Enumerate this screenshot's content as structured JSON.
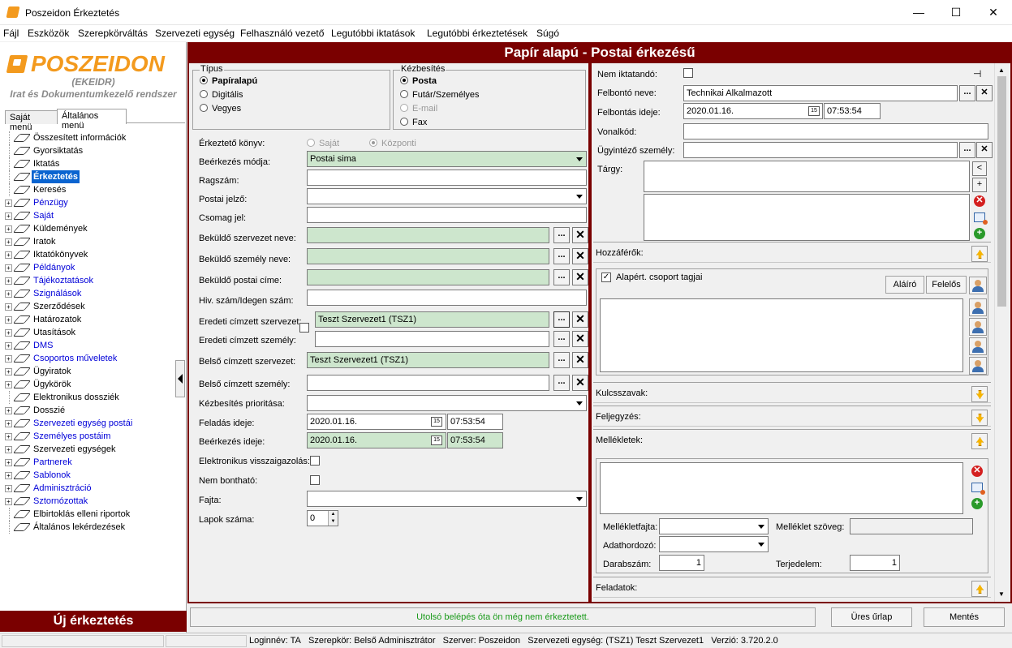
{
  "window": {
    "title": "Poszeidon Érkeztetés",
    "min": "—",
    "max": "☐",
    "close": "✕"
  },
  "menu": [
    "Fájl",
    "Eszközök",
    "Szerepkörváltás",
    "Szervezeti egység",
    "Felhasználó vezető",
    "Legutóbbi iktatások",
    "Legutóbbi érkeztetések",
    "Súgó"
  ],
  "logo": {
    "name": "POSZEIDON",
    "sub1": "(EKEIDR)",
    "sub2": "Irat és Dokumentumkezelő rendszer"
  },
  "left_tabs": [
    "Saját menü",
    "Általános menü"
  ],
  "tree": [
    {
      "label": "Összesített információk",
      "blue": false,
      "exp": false
    },
    {
      "label": "Gyorsiktatás",
      "blue": false,
      "exp": false
    },
    {
      "label": "Iktatás",
      "blue": false,
      "exp": false
    },
    {
      "label": "Érkeztetés",
      "blue": false,
      "exp": false,
      "selected": true
    },
    {
      "label": "Keresés",
      "blue": false,
      "exp": false
    },
    {
      "label": "Pénzügy",
      "blue": true,
      "exp": true
    },
    {
      "label": "Saját",
      "blue": true,
      "exp": true
    },
    {
      "label": "Küldemények",
      "blue": false,
      "exp": true
    },
    {
      "label": "Iratok",
      "blue": false,
      "exp": true
    },
    {
      "label": "Iktatókönyvek",
      "blue": false,
      "exp": true
    },
    {
      "label": "Példányok",
      "blue": true,
      "exp": true
    },
    {
      "label": "Tájékoztatások",
      "blue": true,
      "exp": true
    },
    {
      "label": "Szignálások",
      "blue": true,
      "exp": true
    },
    {
      "label": "Szerződések",
      "blue": false,
      "exp": true
    },
    {
      "label": "Határozatok",
      "blue": false,
      "exp": true
    },
    {
      "label": "Utasítások",
      "blue": false,
      "exp": true
    },
    {
      "label": "DMS",
      "blue": true,
      "exp": true
    },
    {
      "label": "Csoportos műveletek",
      "blue": true,
      "exp": true
    },
    {
      "label": "Ügyiratok",
      "blue": false,
      "exp": true
    },
    {
      "label": "Ügykörök",
      "blue": false,
      "exp": true
    },
    {
      "label": "Elektronikus dossziék",
      "blue": false,
      "exp": false
    },
    {
      "label": "Dosszié",
      "blue": false,
      "exp": true
    },
    {
      "label": "Szervezeti egység postái",
      "blue": true,
      "exp": true
    },
    {
      "label": "Személyes postáim",
      "blue": true,
      "exp": true
    },
    {
      "label": "Szervezeti egységek",
      "blue": false,
      "exp": true
    },
    {
      "label": "Partnerek",
      "blue": true,
      "exp": true
    },
    {
      "label": "Sablonok",
      "blue": true,
      "exp": true
    },
    {
      "label": "Adminisztráció",
      "blue": true,
      "exp": true
    },
    {
      "label": "Sztornózottak",
      "blue": true,
      "exp": true
    },
    {
      "label": "Elbirtoklás elleni riportok",
      "blue": false,
      "exp": false
    },
    {
      "label": "Általános lekérdezések",
      "blue": false,
      "exp": false
    }
  ],
  "new_button": "Új érkeztetés",
  "header": "Papír alapú - Postai érkezésű",
  "tipus": {
    "title": "Típus",
    "options": [
      "Papíralapú",
      "Digitális",
      "Vegyes"
    ]
  },
  "kezbesites": {
    "title": "Kézbesítés",
    "options": [
      "Posta",
      "Futár/Személyes",
      "E-mail",
      "Fax"
    ]
  },
  "form": {
    "erkezteto_konyv": "Érkeztető könyv:",
    "sajat": "Saját",
    "kozponti": "Központi",
    "beerkezes_modja": "Beérkezés módja:",
    "beerkezes_modja_val": "Postai sima",
    "ragszam": "Ragszám:",
    "postai_jelzo": "Postai jelző:",
    "csomag_jel": "Csomag jel:",
    "bekuldo_szerv": "Beküldő szervezet neve:",
    "bekuldo_szemely": "Beküldő személy neve:",
    "bekuldo_cim": "Beküldő postai címe:",
    "hiv_szam": "Hiv. szám/Idegen szám:",
    "eredeti_szerv": "Eredeti címzett szervezet:",
    "eredeti_szerv_val": "Teszt Szervezet1 (TSZ1)",
    "eredeti_szemely": "Eredeti címzett személy:",
    "belso_szerv": "Belső címzett szervezet:",
    "belso_szerv_val": "Teszt Szervezet1 (TSZ1)",
    "belso_szemely": "Belső címzett személy:",
    "prioritas": "Kézbesítés prioritása:",
    "feladas": "Feladás ideje:",
    "feladas_date": "2020.01.16.",
    "feladas_time": "07:53:54",
    "beerkezes": "Beérkezés ideje:",
    "beerkezes_date": "2020.01.16.",
    "beerkezes_time": "07:53:54",
    "elektr": "Elektronikus visszaigazolás:",
    "nem_bonthato": "Nem bontható:",
    "fajta": "Fajta:",
    "lapok": "Lapok száma:",
    "lapok_val": "0",
    "dots": "...",
    "x": "✕",
    "cal": "15"
  },
  "right": {
    "nem_iktatando": "Nem iktatandó:",
    "felbonto": "Felbontó neve:",
    "felbonto_val": "Technikai Alkalmazott",
    "felbontas": "Felbontás ideje:",
    "felbontas_date": "2020.01.16.",
    "felbontas_time": "07:53:54",
    "vonalkod": "Vonalkód:",
    "ugyintezo": "Ügyintéző személy:",
    "targy": "Tárgy:",
    "hozzaferok": "Hozzáférők:",
    "alapert": "Alapért. csoport tagjai",
    "alairo": "Aláíró",
    "felelos": "Felelős",
    "kulcsszavak": "Kulcsszavak:",
    "feljegyzes": "Feljegyzés:",
    "mellekletek": "Mellékletek:",
    "mellekletfajta": "Mellékletfajta:",
    "melleklet_szoveg": "Melléklet szöveg:",
    "adathordozo": "Adathordozó:",
    "darabszam": "Darabszám:",
    "darabszam_val": "1",
    "terjedelem": "Terjedelem:",
    "terjedelem_val": "1",
    "feladatok": "Feladatok:"
  },
  "bottom": {
    "msg": "Utolsó belépés óta ön még nem érkeztetett.",
    "ures": "Üres űrlap",
    "mentes": "Mentés"
  },
  "status": {
    "login": "Loginnév: TA",
    "szerepkor": "Szerepkör: Belső Adminisztrátor",
    "szerver": "Szerver: Poszeidon",
    "egyseg": "Szervezeti egység: (TSZ1) Teszt Szervezet1",
    "verzio": "Verzió: 3.720.2.0"
  },
  "colors": {
    "brand": "#7a0000",
    "logo": "#f39a1e",
    "green_field": "#cde6cd",
    "msg_green": "#1a9a1a"
  }
}
